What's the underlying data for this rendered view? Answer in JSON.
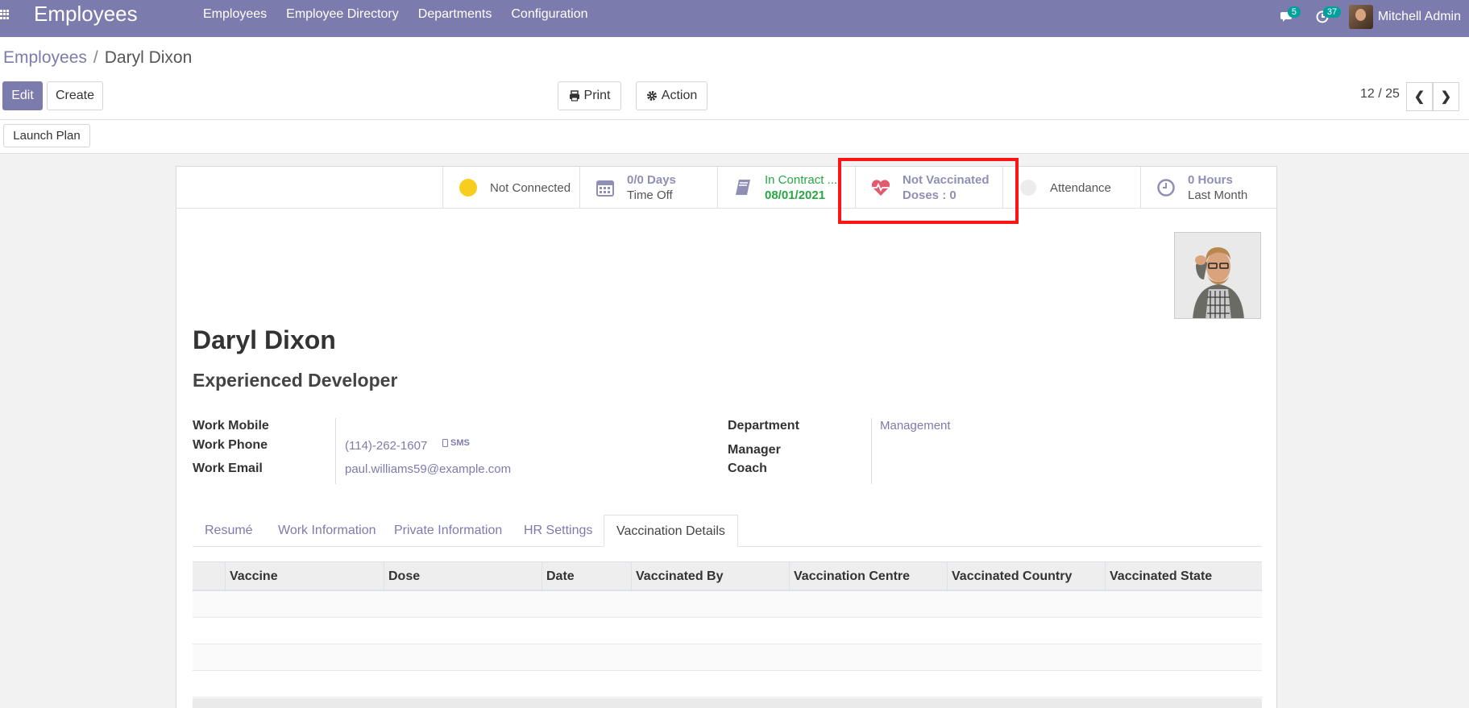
{
  "topbar": {
    "app_title": "Employees",
    "menu": [
      "Employees",
      "Employee Directory",
      "Departments",
      "Configuration"
    ],
    "messages_count": "5",
    "activities_count": "37",
    "user_name": "Mitchell Admin"
  },
  "breadcrumb": {
    "parent": "Employees",
    "separator": "/",
    "current": "Daryl Dixon"
  },
  "toolbar": {
    "edit_label": "Edit",
    "create_label": "Create",
    "print_label": "Print",
    "action_label": "Action",
    "pager": "12 / 25",
    "launch_plan_label": "Launch Plan"
  },
  "smart_buttons": {
    "presence": "Not Connected",
    "time_off_value": "0/0 Days",
    "time_off_label": "Time Off",
    "contract_value": "In Contract ...",
    "contract_date": "08/01/2021",
    "vaccination_value": "Not Vaccinated",
    "vaccination_doses": "Doses : 0",
    "attendance": "Attendance",
    "hours_value": "0 Hours",
    "hours_label": "Last Month"
  },
  "employee": {
    "name": "Daryl Dixon",
    "job_title": "Experienced Developer",
    "work_mobile_label": "Work Mobile",
    "work_phone_label": "Work Phone",
    "work_phone": "(114)-262-1607",
    "sms_label": "SMS",
    "work_email_label": "Work Email",
    "work_email": "paul.williams59@example.com",
    "department_label": "Department",
    "department": "Management",
    "manager_label": "Manager",
    "coach_label": "Coach"
  },
  "tabs": [
    "Resumé",
    "Work Information",
    "Private Information",
    "HR Settings",
    "Vaccination Details"
  ],
  "active_tab": "Vaccination Details",
  "vaccination_table": {
    "columns": [
      "Vaccine",
      "Dose",
      "Date",
      "Vaccinated By",
      "Vaccination Centre",
      "Vaccinated Country",
      "Vaccinated State"
    ]
  },
  "colors": {
    "brand": "#7c7bad",
    "success": "#28a745",
    "highlight": "#ff1414"
  }
}
